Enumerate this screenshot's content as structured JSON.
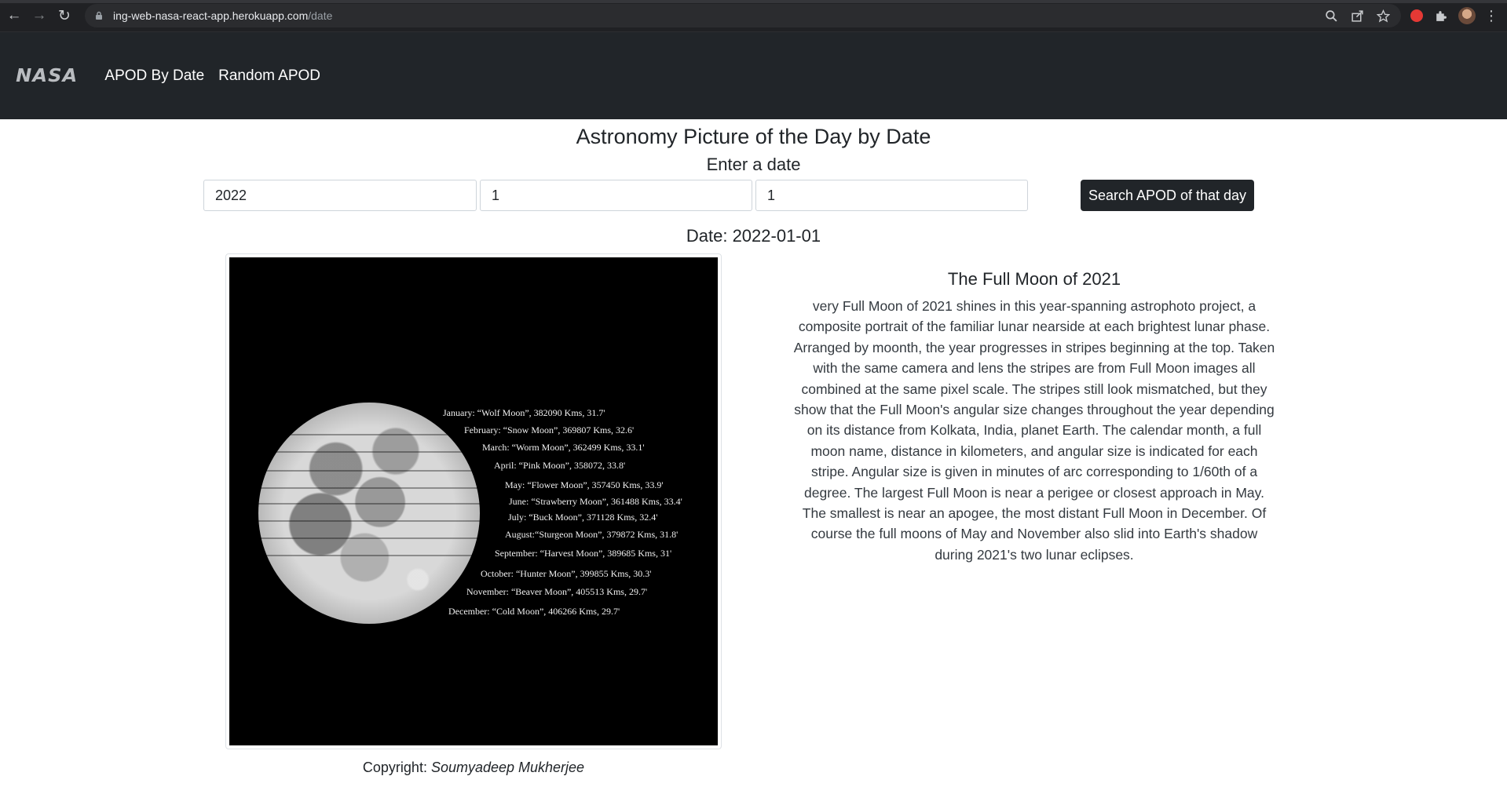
{
  "browser": {
    "url_host": "ing-web-nasa-react-app.herokuapp.com",
    "url_path": "/date"
  },
  "navbar": {
    "logo": "NASA",
    "links": [
      "APOD By Date",
      "Random APOD"
    ]
  },
  "page": {
    "title": "Astronomy Picture of the Day by Date",
    "enter_label": "Enter a date",
    "inputs": {
      "year": "2022",
      "month": "1",
      "day": "1"
    },
    "search_button": "Search APOD of that day",
    "date_line": "Date: 2022-01-01"
  },
  "apod": {
    "image_labels": [
      "January: “Wolf Moon”, 382090 Kms, 31.7'",
      "February: “Snow Moon”, 369807 Kms, 32.6'",
      "March: “Worm Moon”, 362499 Kms, 33.1'",
      "April: “Pink Moon”, 358072, 33.8'",
      "May: “Flower Moon”, 357450 Kms, 33.9'",
      "June: “Strawberry Moon”, 361488 Kms, 33.4'",
      "July: “Buck Moon”, 371128 Kms, 32.4'",
      "August:“Sturgeon Moon”, 379872 Kms, 31.8'",
      "September: “Harvest Moon”, 389685 Kms, 31'",
      "October: “Hunter Moon”, 399855 Kms, 30.3'",
      "November: “Beaver Moon”, 405513 Kms, 29.7'",
      "December: “Cold Moon”, 406266 Kms, 29.7'"
    ],
    "copyright_label": "Copyright: ",
    "copyright_name": "Soumyadeep Mukherjee",
    "title": "The Full Moon of 2021",
    "explanation": "very Full Moon of 2021 shines in this year-spanning astrophoto project, a composite portrait of the familiar lunar nearside at each brightest lunar phase. Arranged by moonth, the year progresses in stripes beginning at the top. Taken with the same camera and lens the stripes are from Full Moon images all combined at the same pixel scale. The stripes still look mismatched, but they show that the Full Moon's angular size changes throughout the year depending on its distance from Kolkata, India, planet Earth. The calendar month, a full moon name, distance in kilometers, and angular size is indicated for each stripe. Angular size is given in minutes of arc corresponding to 1/60th of a degree. The largest Full Moon is near a perigee or closest approach in May. The smallest is near an apogee, the most distant Full Moon in December. Of course the full moons of May and November also slid into Earth's shadow during 2021's two lunar eclipses."
  }
}
